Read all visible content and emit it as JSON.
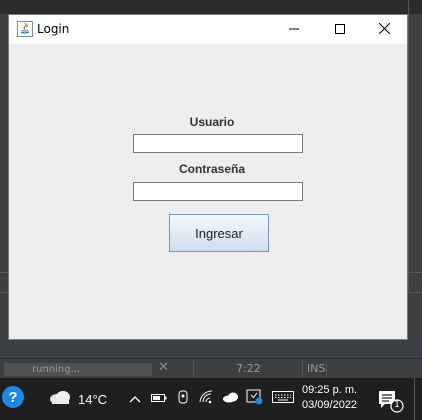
{
  "window": {
    "title": "Login",
    "buttons": {
      "minimize": "minimize-icon",
      "maximize": "maximize-icon",
      "close": "close-icon"
    }
  },
  "form": {
    "user_label": "Usuario",
    "user_value": "",
    "password_label": "Contraseña",
    "password_value": "",
    "submit_label": "Ingresar"
  },
  "ide_status": {
    "progress_text": "running...",
    "cancel_glyph": "✕",
    "caret_position": "7:22",
    "insert_mode": "INS"
  },
  "taskbar": {
    "temperature": "14°C",
    "time": "09:25 p. m.",
    "date": "03/09/2022",
    "notification_count": "1"
  },
  "colors": {
    "window_bg": "#eeeeee",
    "button_border": "#7a96b4",
    "taskbar_bg": "#1f1f1f"
  }
}
